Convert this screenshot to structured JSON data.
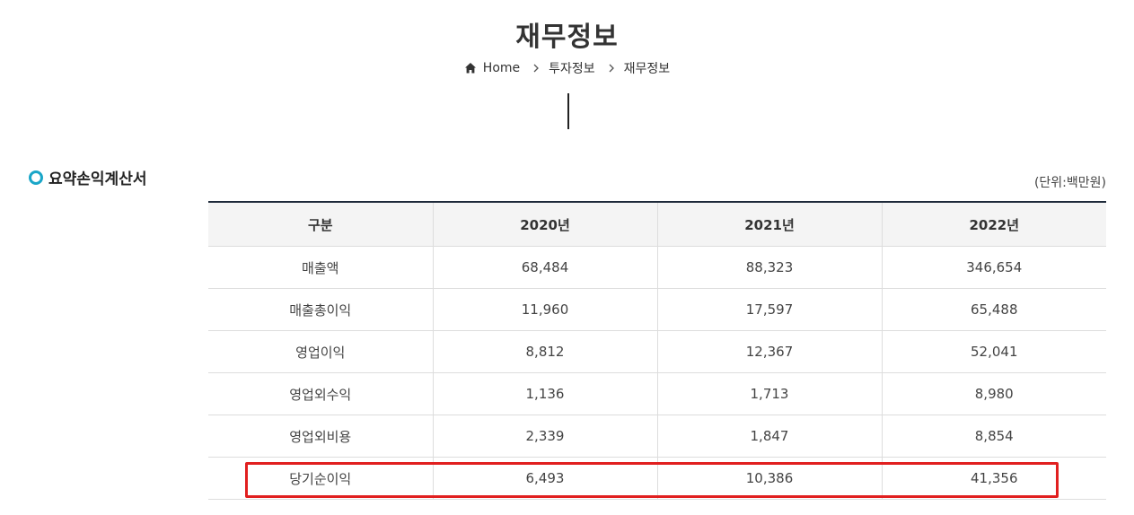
{
  "page": {
    "title": "재무정보"
  },
  "breadcrumb": {
    "home_label": "Home",
    "items": [
      "투자정보",
      "재무정보"
    ],
    "home_icon": "home-icon",
    "separator_icon": "chevron-right-icon"
  },
  "section": {
    "title": "요약손익계산서",
    "icon": "circle-bullet-icon",
    "accent_color": "#1aa6c8"
  },
  "unit": "(단위:백만원)",
  "table": {
    "headers": [
      "구분",
      "2020년",
      "2021년",
      "2022년"
    ],
    "rows": [
      [
        "매출액",
        "68,484",
        "88,323",
        "346,654"
      ],
      [
        "매출총이익",
        "11,960",
        "17,597",
        "65,488"
      ],
      [
        "영업이익",
        "8,812",
        "12,367",
        "52,041"
      ],
      [
        "영업외수익",
        "1,136",
        "1,713",
        "8,980"
      ],
      [
        "영업외비용",
        "2,339",
        "1,847",
        "8,854"
      ],
      [
        "당기순이익",
        "6,493",
        "10,386",
        "41,356"
      ]
    ]
  },
  "highlight": {
    "color": "#e11f1f"
  }
}
